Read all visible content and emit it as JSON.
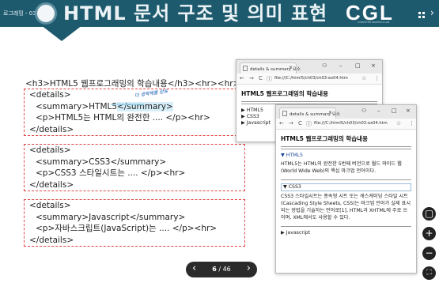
{
  "header": {
    "breadcrumb": "로그래밍 - 03",
    "title": "HTML 문서 구조 및 의미 표현",
    "brand": "CGL",
    "brand_sub": "COMPUTER GRAPHICS LAB.",
    "nav_arrow": "›"
  },
  "code": {
    "h3_line": "<h3>HTML5 웹프로그래밍의 학습내용</h3><hr><hr>",
    "annotation": "더 생략해볼 완료",
    "blocks": [
      {
        "lines": [
          "<details>",
          "<summary>HTML5</summary>",
          "<p>HTML5는 HTML의 완전한 .... </p><hr>",
          "</details>"
        ]
      },
      {
        "lines": [
          "<details>",
          "<summary>CSS3</summary>",
          "<p>CSS3 스타일시트는  .... </p><hr>",
          "</details>"
        ]
      },
      {
        "lines": [
          "<details>",
          "<summary>Javascript</summary>",
          "<p>자바스크립트(JavaScript)는  .... </p><hr>",
          "</details>"
        ]
      }
    ]
  },
  "browser_back": {
    "tab_title": "details & summary 요소",
    "tab_close": "×",
    "url": "file:///C:/html5/ch03/ch03-ex04.htm",
    "heading": "HTML5 웹프로그래밍의 학습내용",
    "summaries": [
      "▶ HTML5",
      "▶ CSS3",
      "▶ Javascript"
    ]
  },
  "browser_front": {
    "tab_title": "details & summary 요소",
    "tab_close": "×",
    "url": "file:///C:/html5/ch03/ch03-ex04.htm",
    "heading": "HTML5 웹프로그래밍의 학습내용",
    "sections": [
      {
        "summary": "▼ HTML5",
        "text": "HTML5는 HTML의 완전한 5번째 버전으로 월드 와이드 웹 (World Wide Web)의 핵심 마크업 언어이다."
      },
      {
        "summary": "▼ CSS3",
        "text": "CSS3 스타일시트는 종속형 시트 또는 캐스케이딩 스타일 시트(Cascading Style Sheets, CSS)는 마크업 언어가 실제 표시되는 방법을 기술하는 언어로[1], HTML과 XHTML에 주로 쓰이며, XML에서도 사용할 수 있다."
      },
      {
        "summary": "▶ Javascript",
        "text": ""
      }
    ]
  },
  "window_controls": {
    "profile": "⚇",
    "minimize": "–",
    "maximize": "□",
    "close": "×"
  },
  "nav_controls": {
    "back": "←",
    "forward": "→",
    "reload": "C",
    "info": "ⓘ",
    "star": "☆",
    "menu": "⋮"
  },
  "right_controls": [
    {
      "name": "page-view-button",
      "glyph": "▢"
    },
    {
      "name": "zoom-in-button",
      "glyph": "+"
    },
    {
      "name": "zoom-out-button",
      "glyph": "−"
    },
    {
      "name": "fullscreen-button",
      "glyph": "⛶"
    }
  ],
  "pager": {
    "prev": "‹",
    "current": "6",
    "sep": " / ",
    "total": "46",
    "next": "›"
  }
}
